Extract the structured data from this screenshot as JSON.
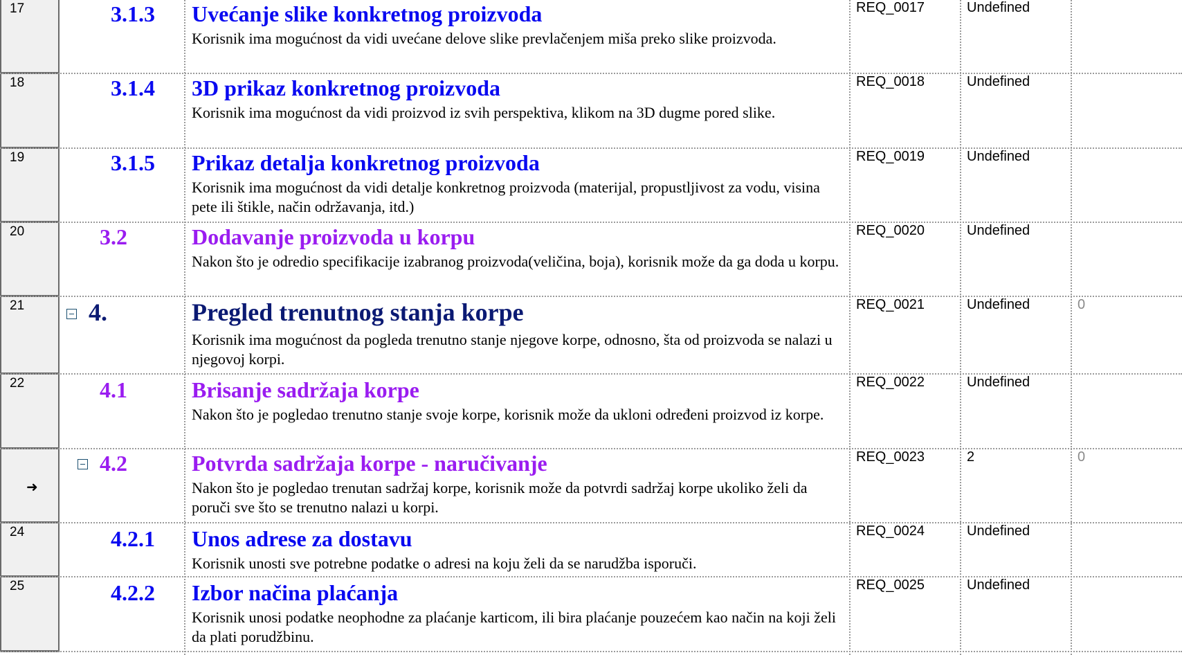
{
  "rows": [
    {
      "num": "17",
      "level": "3.1.3",
      "title": "Uvećanje slike konkretnog proizvoda",
      "desc": "Korisnik ima mogućnost da vidi uvećane delove slike prevlačenjem miša preko slike proizvoda.",
      "req": "REQ_0017",
      "status": "Undefined",
      "count": ""
    },
    {
      "num": "18",
      "level": "3.1.4",
      "title": "3D prikaz konkretnog proizvoda",
      "desc": "Korisnik ima mogućnost da vidi proizvod iz svih perspektiva, klikom na 3D dugme pored slike.",
      "req": "REQ_0018",
      "status": "Undefined",
      "count": ""
    },
    {
      "num": "19",
      "level": "3.1.5",
      "title": "Prikaz detalja konkretnog proizvoda",
      "desc": "Korisnik ima mogućnost da vidi detalje konkretnog proizvoda (materijal, propustljivost za vodu, visina pete ili štikle, način održavanja, itd.)",
      "req": "REQ_0019",
      "status": "Undefined",
      "count": ""
    },
    {
      "num": "20",
      "level": "3.2",
      "title": "Dodavanje proizvoda u korpu",
      "desc": "Nakon što je odredio specifikacije izabranog proizvoda(veličina, boja), korisnik može da ga doda u korpu.",
      "req": "REQ_0020",
      "status": "Undefined",
      "count": ""
    },
    {
      "num": "21",
      "level": "4.",
      "title": "Pregled trenutnog stanja korpe",
      "desc": "Korisnik ima mogućnost da pogleda trenutno stanje njegove korpe, odnosno, šta od proizvoda se nalazi u njegovoj korpi.",
      "req": "REQ_0021",
      "status": "Undefined",
      "count": "0"
    },
    {
      "num": "22",
      "level": "4.1",
      "title": "Brisanje sadržaja korpe",
      "desc": "Nakon što je pogledao trenutno stanje svoje korpe, korisnik može da ukloni određeni proizvod iz korpe.",
      "req": "REQ_0022",
      "status": "Undefined",
      "count": ""
    },
    {
      "num": "",
      "current_marker": "➜",
      "level": "4.2",
      "title": "Potvrda sadržaja korpe - naručivanje",
      "desc": "Nakon što je pogledao trenutan sadržaj korpe, korisnik može da potvrdi sadržaj korpe ukoliko želi da poruči sve što se trenutno nalazi u korpi.",
      "req": "REQ_0023",
      "status": "2",
      "count": "0"
    },
    {
      "num": "24",
      "level": "4.2.1",
      "title": "Unos adrese za dostavu",
      "desc": "Korisnik unosti sve potrebne podatke o adresi na koju želi da se narudžba isporuči.",
      "req": "REQ_0024",
      "status": "Undefined",
      "count": ""
    },
    {
      "num": "25",
      "level": "4.2.2",
      "title": "Izbor načina plaćanja",
      "desc": "Korisnik unosi podatke neophodne za plaćanje karticom, ili bira plaćanje pouzećem kao način na koji želi da plati porudžbinu.",
      "req": "REQ_0025",
      "status": "Undefined",
      "count": ""
    }
  ],
  "colors": {
    "level1": "#0b1a73",
    "level2": "#9a1cf0",
    "level3": "#0a0af0",
    "count_text": "#8a8a8a"
  }
}
